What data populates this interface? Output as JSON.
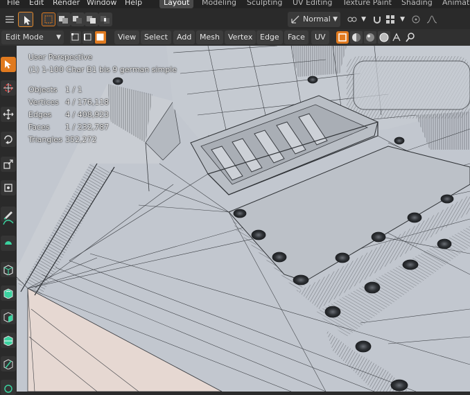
{
  "menus": [
    "File",
    "Edit",
    "Render",
    "Window",
    "Help"
  ],
  "workspaces": [
    "Layout",
    "Modeling",
    "Sculpting",
    "UV Editing",
    "Texture Paint",
    "Shading",
    "Animati"
  ],
  "active_workspace": "Layout",
  "toolbar": {
    "orientation_label": "Normal",
    "mode_label": "Edit Mode"
  },
  "header_menus": [
    "View",
    "Select",
    "Add",
    "Mesh",
    "Vertex",
    "Edge",
    "Face",
    "UV"
  ],
  "viewport": {
    "perspective": "User Perspective",
    "object_name": "(1) 1-100 Char B1 bis 9 german simple",
    "stats": [
      {
        "label": "Objects",
        "value": "1 / 1"
      },
      {
        "label": "Vertices",
        "value": "4 / 176,118"
      },
      {
        "label": "Edges",
        "value": "4 / 408,923"
      },
      {
        "label": "Faces",
        "value": "1 / 232,787"
      },
      {
        "label": "Triangles",
        "value": "352,272"
      }
    ]
  },
  "colors": {
    "accent": "#e07a1f",
    "mesh_bg": "#c2c7cf",
    "wire": "#3a3d42",
    "selected_face": "#e6d8d2"
  },
  "tools": [
    "select-box-icon",
    "cursor-icon",
    "move-icon",
    "rotate-icon",
    "scale-icon",
    "transform-icon",
    "annotate-icon",
    "measure-icon",
    "add-cube-icon",
    "extrude-icon",
    "inset-icon",
    "bevel-icon",
    "loopcut-icon",
    "knife-icon"
  ]
}
